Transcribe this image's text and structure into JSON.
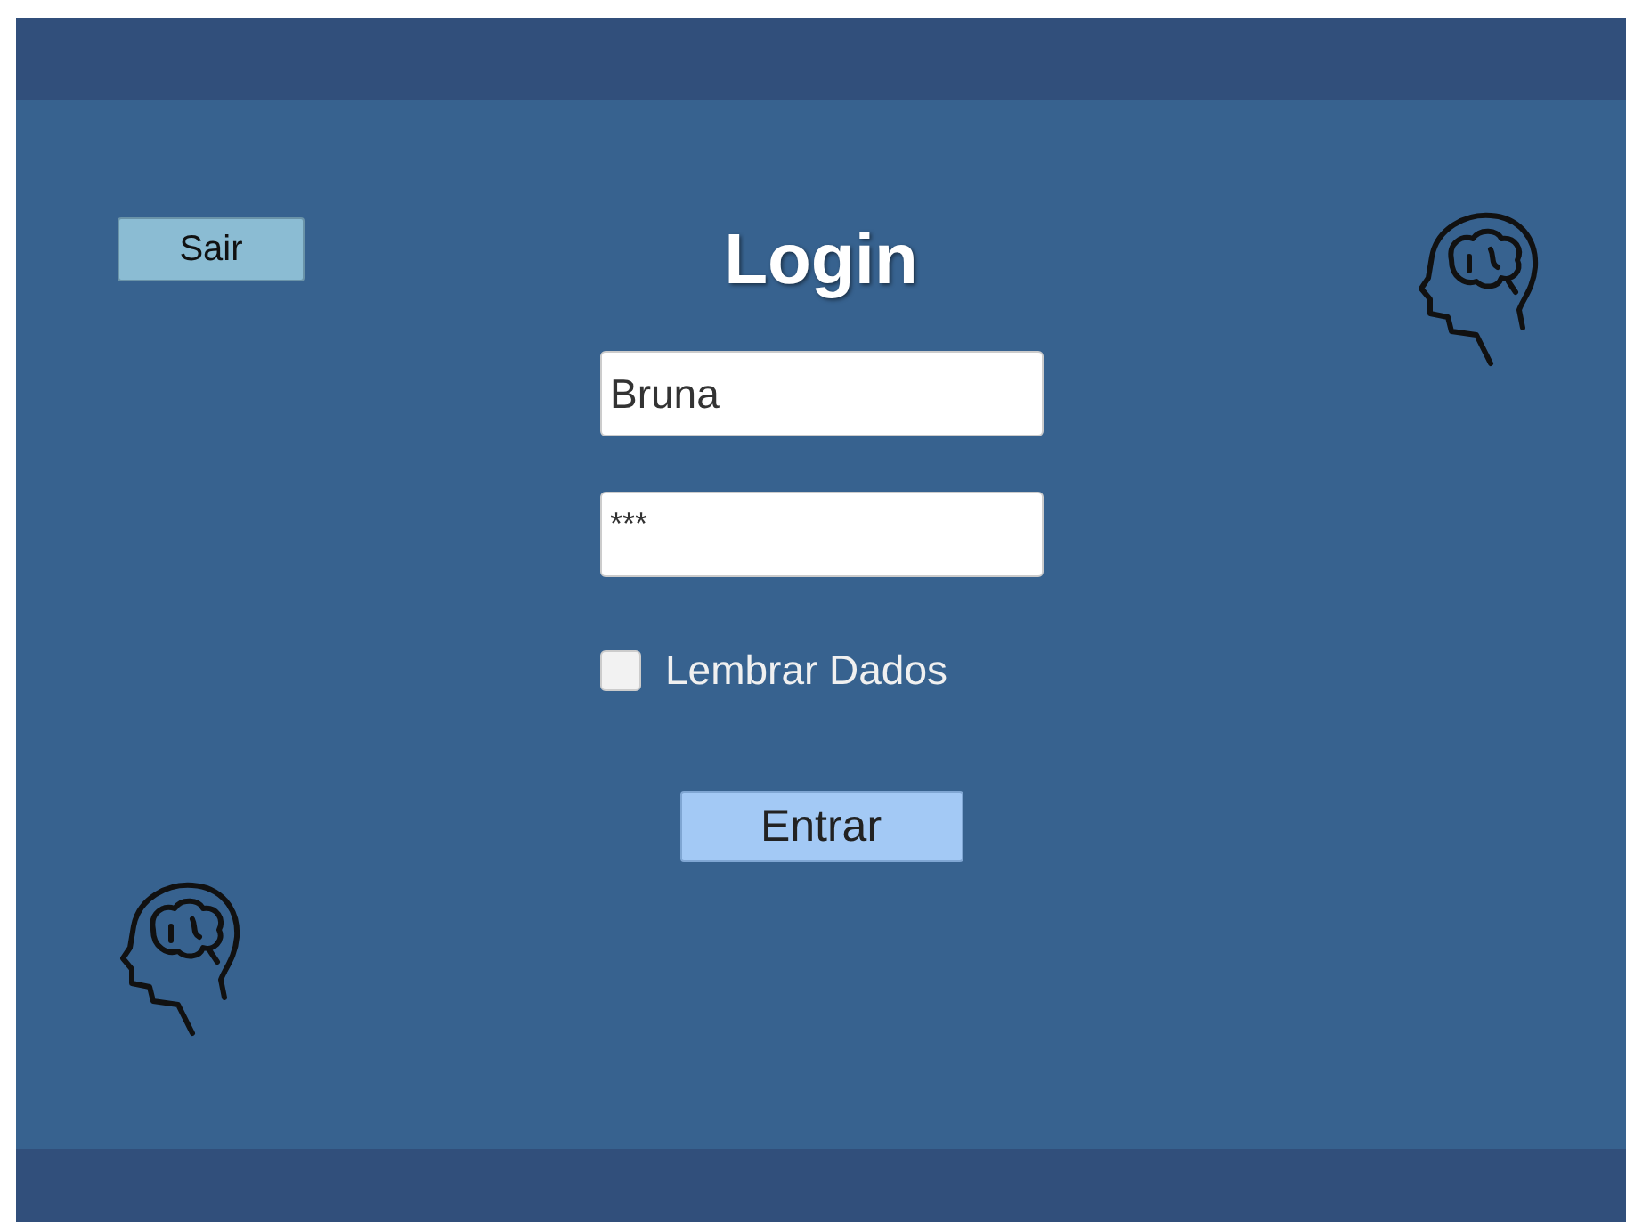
{
  "exit_button": "Sair",
  "title": "Login",
  "username": {
    "value": "Bruna"
  },
  "password": {
    "value": "***"
  },
  "remember": {
    "label": "Lembrar Dados",
    "checked": false
  },
  "submit_button": "Entrar"
}
